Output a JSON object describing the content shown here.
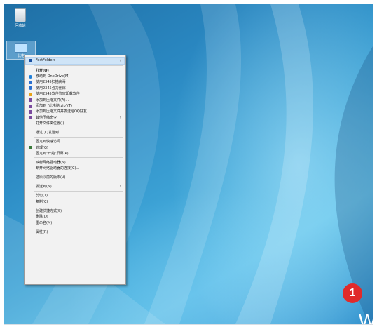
{
  "desktop": {
    "icons": [
      {
        "label": "回收站"
      },
      {
        "label": "此电"
      }
    ],
    "callout_number": "1",
    "brand_fragment": "W"
  },
  "context_menu": {
    "items": [
      {
        "label": "FastFolders",
        "icon": "folder-icon",
        "has_submenu": true,
        "highlighted": true
      },
      {
        "label": "打开(O)",
        "bold": true
      },
      {
        "label": "移动到 OneDrive(M)",
        "icon": "cloud-icon"
      },
      {
        "label": "使用2345扫描病毒",
        "icon": "shield-icon"
      },
      {
        "label": "使用2345强力删除",
        "icon": "shield-icon"
      },
      {
        "label": "使用2345软件管家卸载软件",
        "icon": "box-icon"
      },
      {
        "label": "添加到压缩文件(A)...",
        "icon": "archive-icon"
      },
      {
        "label": "添加到 \"此电脑.zip\"(T)",
        "icon": "archive-icon"
      },
      {
        "label": "添加到压缩文件并发送给QQ好友",
        "icon": "archive-icon"
      },
      {
        "label": "其他压缩命令",
        "icon": "archive-icon",
        "has_submenu": true
      },
      {
        "label": "打开文件夹位置(I)"
      },
      {
        "label": "通过QQ发送到"
      },
      {
        "label": "固定到快速访问"
      },
      {
        "label": "管理(G)",
        "icon": "manage-icon"
      },
      {
        "label": "固定到\"开始\"屏幕(P)"
      },
      {
        "label": "映射网络驱动器(N)..."
      },
      {
        "label": "断开网络驱动器的连接(C)..."
      },
      {
        "label": "还原以前的版本(V)"
      },
      {
        "label": "发送到(N)",
        "has_submenu": true
      },
      {
        "label": "剪切(T)"
      },
      {
        "label": "复制(C)"
      },
      {
        "label": "创建快捷方式(S)"
      },
      {
        "label": "删除(D)"
      },
      {
        "label": "重命名(M)"
      },
      {
        "label": "属性(R)"
      }
    ],
    "icon_colors": {
      "folder-icon": "#1a4fa0",
      "cloud-icon": "#1f7fd8",
      "shield-icon": "#2a6fd0",
      "box-icon": "#e8a318",
      "archive-icon": "#7a4a9e",
      "manage-icon": "#3a7a3a"
    }
  }
}
